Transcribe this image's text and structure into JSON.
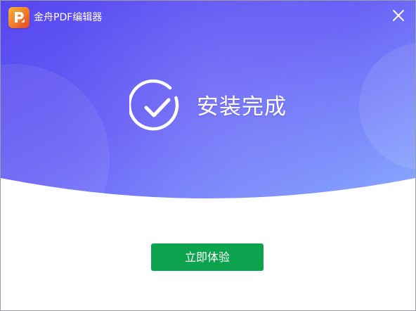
{
  "window": {
    "title": "金舟PDF编辑器"
  },
  "icons": {
    "app_logo": "pdf-editor-logo-icon",
    "close": "close-icon",
    "status": "check-circle-icon"
  },
  "status": {
    "message": "安装完成"
  },
  "actions": {
    "primary_label": "立即体验"
  },
  "colors": {
    "hero_gradient_start": "#5a4cf2",
    "hero_gradient_end": "#86a9ff",
    "primary_button": "#0da24d",
    "logo_orange": "#f07a2a"
  }
}
